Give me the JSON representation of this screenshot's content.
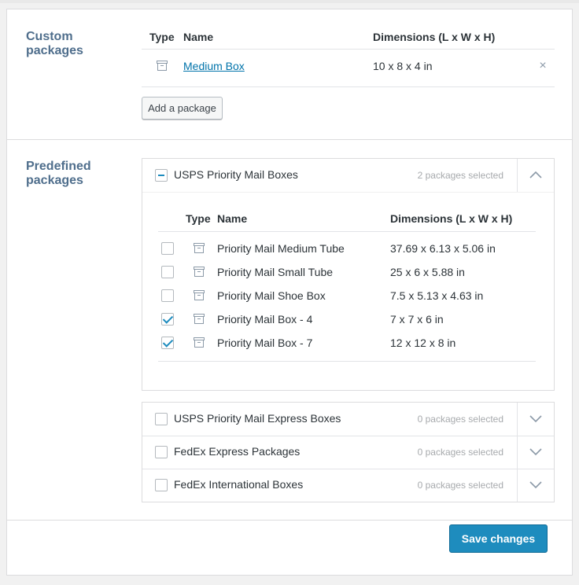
{
  "custom_packages": {
    "title": "Custom packages",
    "headers": {
      "type": "Type",
      "name": "Name",
      "dimensions": "Dimensions (L x W x H)"
    },
    "rows": [
      {
        "icon": "box-icon",
        "name": "Medium Box",
        "dimensions": "10 x 8 x 4 in",
        "remove": "×"
      }
    ],
    "add_button": "Add a package"
  },
  "predefined_packages": {
    "title": "Predefined packages",
    "groups": [
      {
        "name": "USPS Priority Mail Boxes",
        "count": "2 packages selected",
        "state": "indeterminate",
        "expanded": true,
        "headers": {
          "type": "Type",
          "name": "Name",
          "dimensions": "Dimensions (L x W x H)"
        },
        "items": [
          {
            "checked": false,
            "name": "Priority Mail Medium Tube",
            "dimensions": "37.69 x 6.13 x 5.06 in"
          },
          {
            "checked": false,
            "name": "Priority Mail Small Tube",
            "dimensions": "25 x 6 x 5.88 in"
          },
          {
            "checked": false,
            "name": "Priority Mail Shoe Box",
            "dimensions": "7.5 x 5.13 x 4.63 in"
          },
          {
            "checked": true,
            "name": "Priority Mail Box - 4",
            "dimensions": "7 x 7 x 6 in"
          },
          {
            "checked": true,
            "name": "Priority Mail Box - 7",
            "dimensions": "12 x 12 x 8 in"
          }
        ]
      },
      {
        "name": "USPS Priority Mail Express Boxes",
        "count": "0 packages selected",
        "state": "unchecked",
        "expanded": false
      },
      {
        "name": "FedEx Express Packages",
        "count": "0 packages selected",
        "state": "unchecked",
        "expanded": false
      },
      {
        "name": "FedEx International Boxes",
        "count": "0 packages selected",
        "state": "unchecked",
        "expanded": false
      }
    ]
  },
  "footer": {
    "save_button": "Save changes"
  },
  "colors": {
    "accent": "#1e8cbe",
    "link": "#0073aa",
    "section_title": "#4f6e8c",
    "muted": "#a7aaad"
  }
}
